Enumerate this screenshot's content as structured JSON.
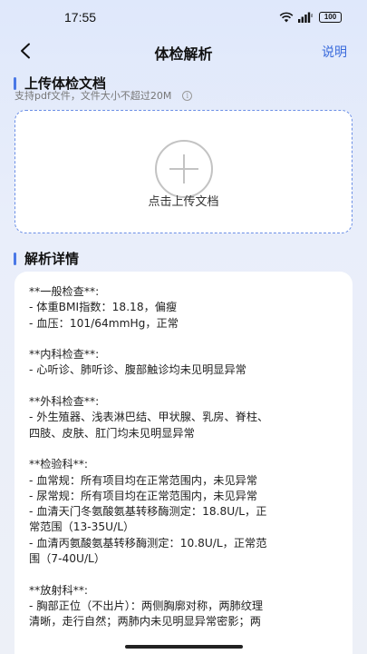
{
  "status_bar": {
    "time": "17:55",
    "battery": "100"
  },
  "nav": {
    "title": "体检解析",
    "help_label": "说明"
  },
  "upload_section": {
    "title": "上传体检文档",
    "hint": "支持pdf文件，文件大小不超过20M",
    "button_label": "点击上传文档"
  },
  "result_section": {
    "title": "解析详情",
    "lines": [
      "**一般检查**:",
      "- 体重BMI指数：18.18，偏瘦",
      "- 血压：101/64mmHg，正常",
      "",
      "**内科检查**:",
      "- 心听诊、肺听诊、腹部触诊均未见明显异常",
      "",
      "**外科检查**:",
      "- 外生殖器、浅表淋巴结、甲状腺、乳房、脊柱、",
      "四肢、皮肤、肛门均未见明显异常",
      "",
      "**检验科**:",
      "- 血常规：所有项目均在正常范围内，未见异常",
      "- 尿常规：所有项目均在正常范围内，未见异常",
      "- 血清天门冬氨酸氨基转移酶测定：18.8U/L，正",
      "常范围（13-35U/L）",
      "- 血清丙氨酸氨基转移酶测定：10.8U/L，正常范",
      "围（7-40U/L）",
      "",
      "**放射科**:",
      "- 胸部正位（不出片）：两侧胸廓对称，两肺纹理",
      "清晰，走行自然；两肺内未见明显异常密影；两"
    ]
  }
}
